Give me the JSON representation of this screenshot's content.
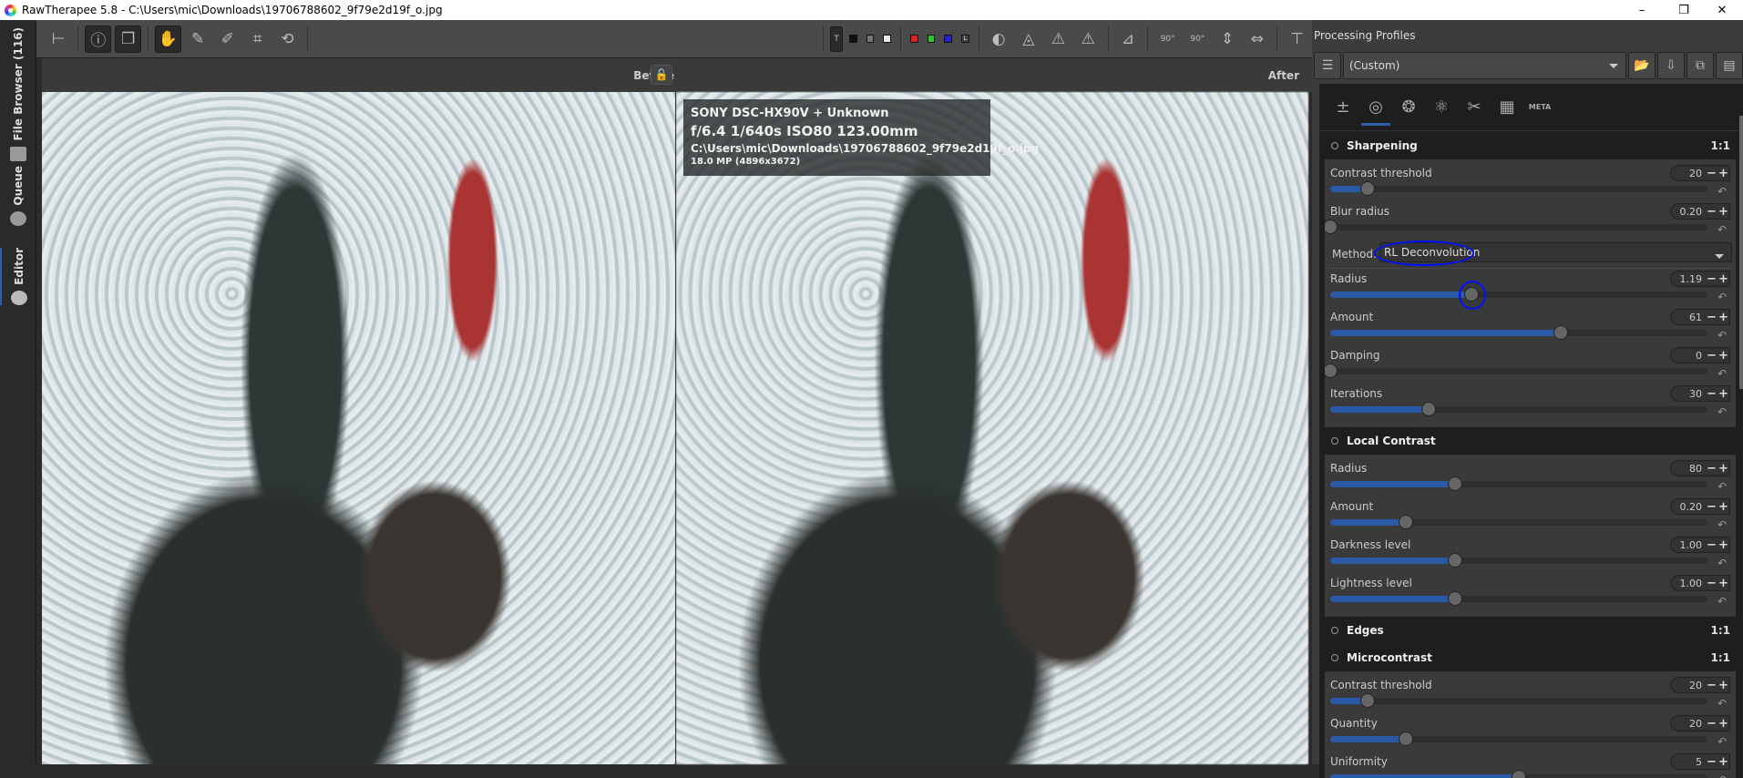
{
  "window": {
    "title": "RawTherapee 5.8 - C:\\Users\\mic\\Downloads\\19706788602_9f79e2d19f_o.jpg",
    "minimize": "–",
    "maximize": "❐",
    "close": "✕"
  },
  "left_tabs": [
    {
      "label": "File Browser (116)"
    },
    {
      "label": "Queue"
    },
    {
      "label": "Editor"
    }
  ],
  "toolbar": {
    "preview_mode": "T",
    "channel_l": "L",
    "rotate_left": "90°",
    "rotate_right": "90°"
  },
  "viewer": {
    "before_label": "Before",
    "after_label": "After"
  },
  "info_overlay": {
    "camera": "SONY DSC-HX90V + Unknown",
    "exposure": "f/6.4  1/640s  ISO80  123.00mm",
    "path": "C:\\Users\\mic\\Downloads\\19706788602_9f79e2d19f_o.jpg",
    "size": "18.0 MP (4896x3672)"
  },
  "profiles": {
    "label": "Processing Profiles",
    "selected": "(Custom)"
  },
  "tool_tabs": [
    "exposure",
    "details",
    "color",
    "advanced",
    "transform",
    "raw",
    "metadata"
  ],
  "tool_tab_meta_label": "META",
  "sections": [
    {
      "title": "Sharpening",
      "ratio": "1:1",
      "rows": [
        {
          "label": "Contrast threshold",
          "value": "20",
          "fraction": 0.1
        },
        {
          "label": "Blur radius",
          "value": "0.20",
          "fraction": 0
        },
        {
          "method_label": "Method:",
          "method_value": "RL Deconvolution"
        },
        {
          "label": "Radius",
          "value": "1.19",
          "fraction": 0.375
        },
        {
          "label": "Amount",
          "value": "61",
          "fraction": 0.61
        },
        {
          "label": "Damping",
          "value": "0",
          "fraction": 0
        },
        {
          "label": "Iterations",
          "value": "30",
          "fraction": 0.26
        }
      ]
    },
    {
      "title": "Local Contrast",
      "ratio": "",
      "rows": [
        {
          "label": "Radius",
          "value": "80",
          "fraction": 0.33
        },
        {
          "label": "Amount",
          "value": "0.20",
          "fraction": 0.2
        },
        {
          "label": "Darkness level",
          "value": "1.00",
          "fraction": 0.33
        },
        {
          "label": "Lightness level",
          "value": "1.00",
          "fraction": 0.33
        }
      ]
    },
    {
      "title": "Edges",
      "ratio": "1:1",
      "rows": []
    },
    {
      "title": "Microcontrast",
      "ratio": "1:1",
      "rows": [
        {
          "label": "Contrast threshold",
          "value": "20",
          "fraction": 0.1
        },
        {
          "label": "Quantity",
          "value": "20",
          "fraction": 0.2
        },
        {
          "label": "Uniformity",
          "value": "5",
          "fraction": 0.5
        }
      ]
    }
  ],
  "colors": {
    "accent": "#2a5aa6",
    "annotation": "#0010ff"
  }
}
